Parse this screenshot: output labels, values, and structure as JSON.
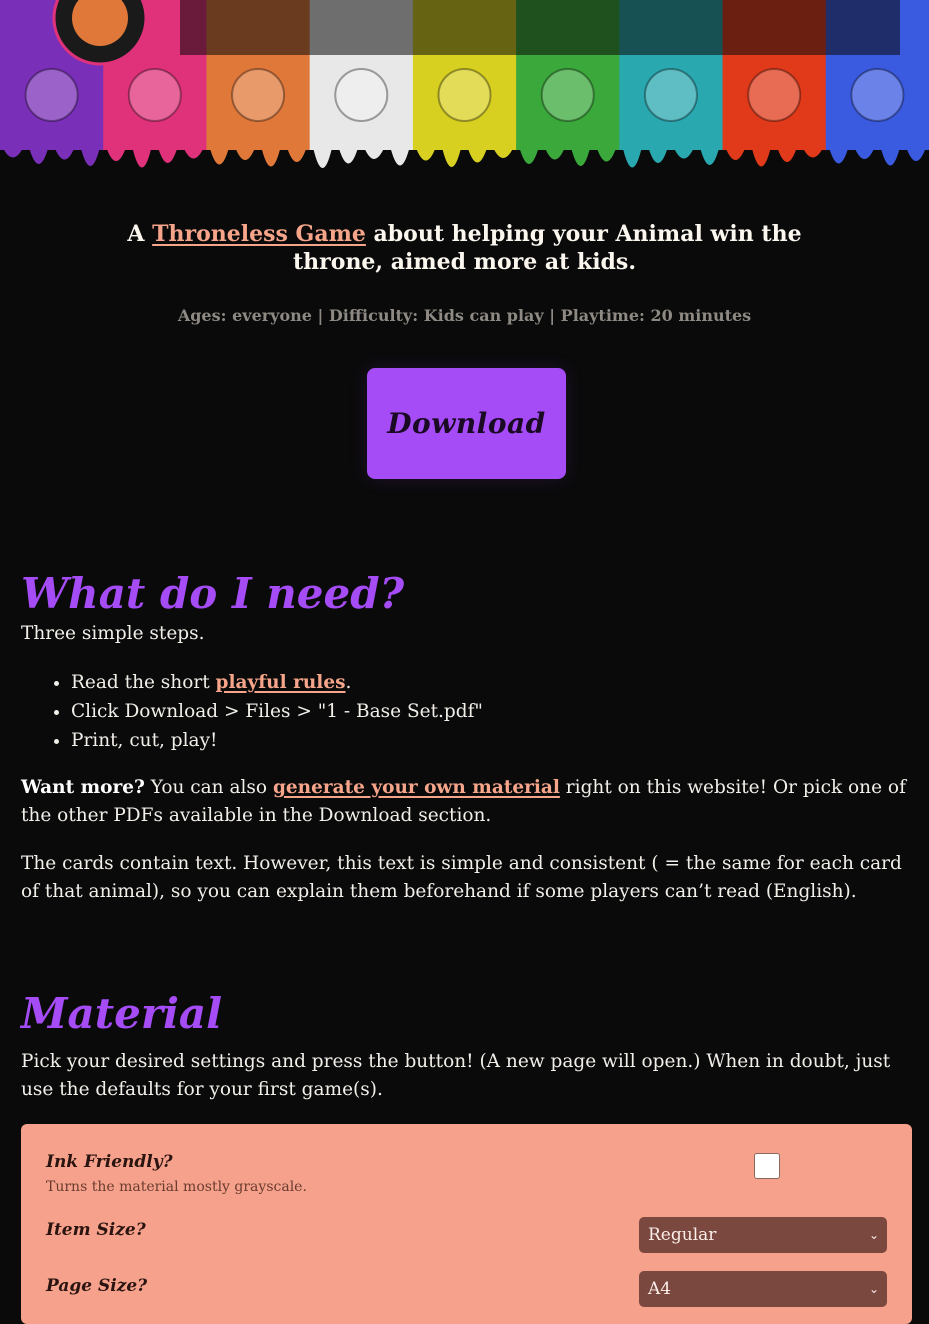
{
  "banner": {
    "banner_colors": [
      "#7a2fb8",
      "#e0327a",
      "#e0783a",
      "#e8e8e8",
      "#d8d020",
      "#3aa83a",
      "#2aa8b0",
      "#e03a1a",
      "#3a5ae0"
    ]
  },
  "intro": {
    "tagline_prefix": "A ",
    "tagline_link": "Throneless Game",
    "tagline_suffix": " about helping your Animal win the",
    "tagline_line2": "throne, aimed more at kids.",
    "meta": "Ages: everyone | Difficulty: Kids can play | Playtime: 20 minutes",
    "download_label": "Download",
    "accent_color": "#a54cf7",
    "link_color": "#f7a58a"
  },
  "need": {
    "heading": "What do I need?",
    "lead": "Three simple steps.",
    "step1_prefix": "Read the short ",
    "step1_link": "playful rules",
    "step1_suffix": ".",
    "step2": "Click Download > Files > \"1 - Base Set.pdf\"",
    "step3": "Print, cut, play!",
    "more_bold": "Want more?",
    "more_text1": " You can also ",
    "more_link": "generate your own material",
    "more_text2": " right on this website! Or pick one of the other PDFs available in the Download section.",
    "cards_note": "The cards contain text. However, this text is simple and consistent ( = the same for each card of that animal), so you can explain them beforehand if some players can’t read (English)."
  },
  "material": {
    "heading": "Material",
    "intro": "Pick your desired settings and press the button! (A new page will open.) When in doubt, just use the defaults for your first game(s).",
    "ink_label": "Ink Friendly?",
    "ink_help": "Turns the material mostly grayscale.",
    "ink_checked": false,
    "item_size_label": "Item Size?",
    "item_size_value": "Regular",
    "page_size_label": "Page Size?",
    "page_size_value": "A4"
  }
}
